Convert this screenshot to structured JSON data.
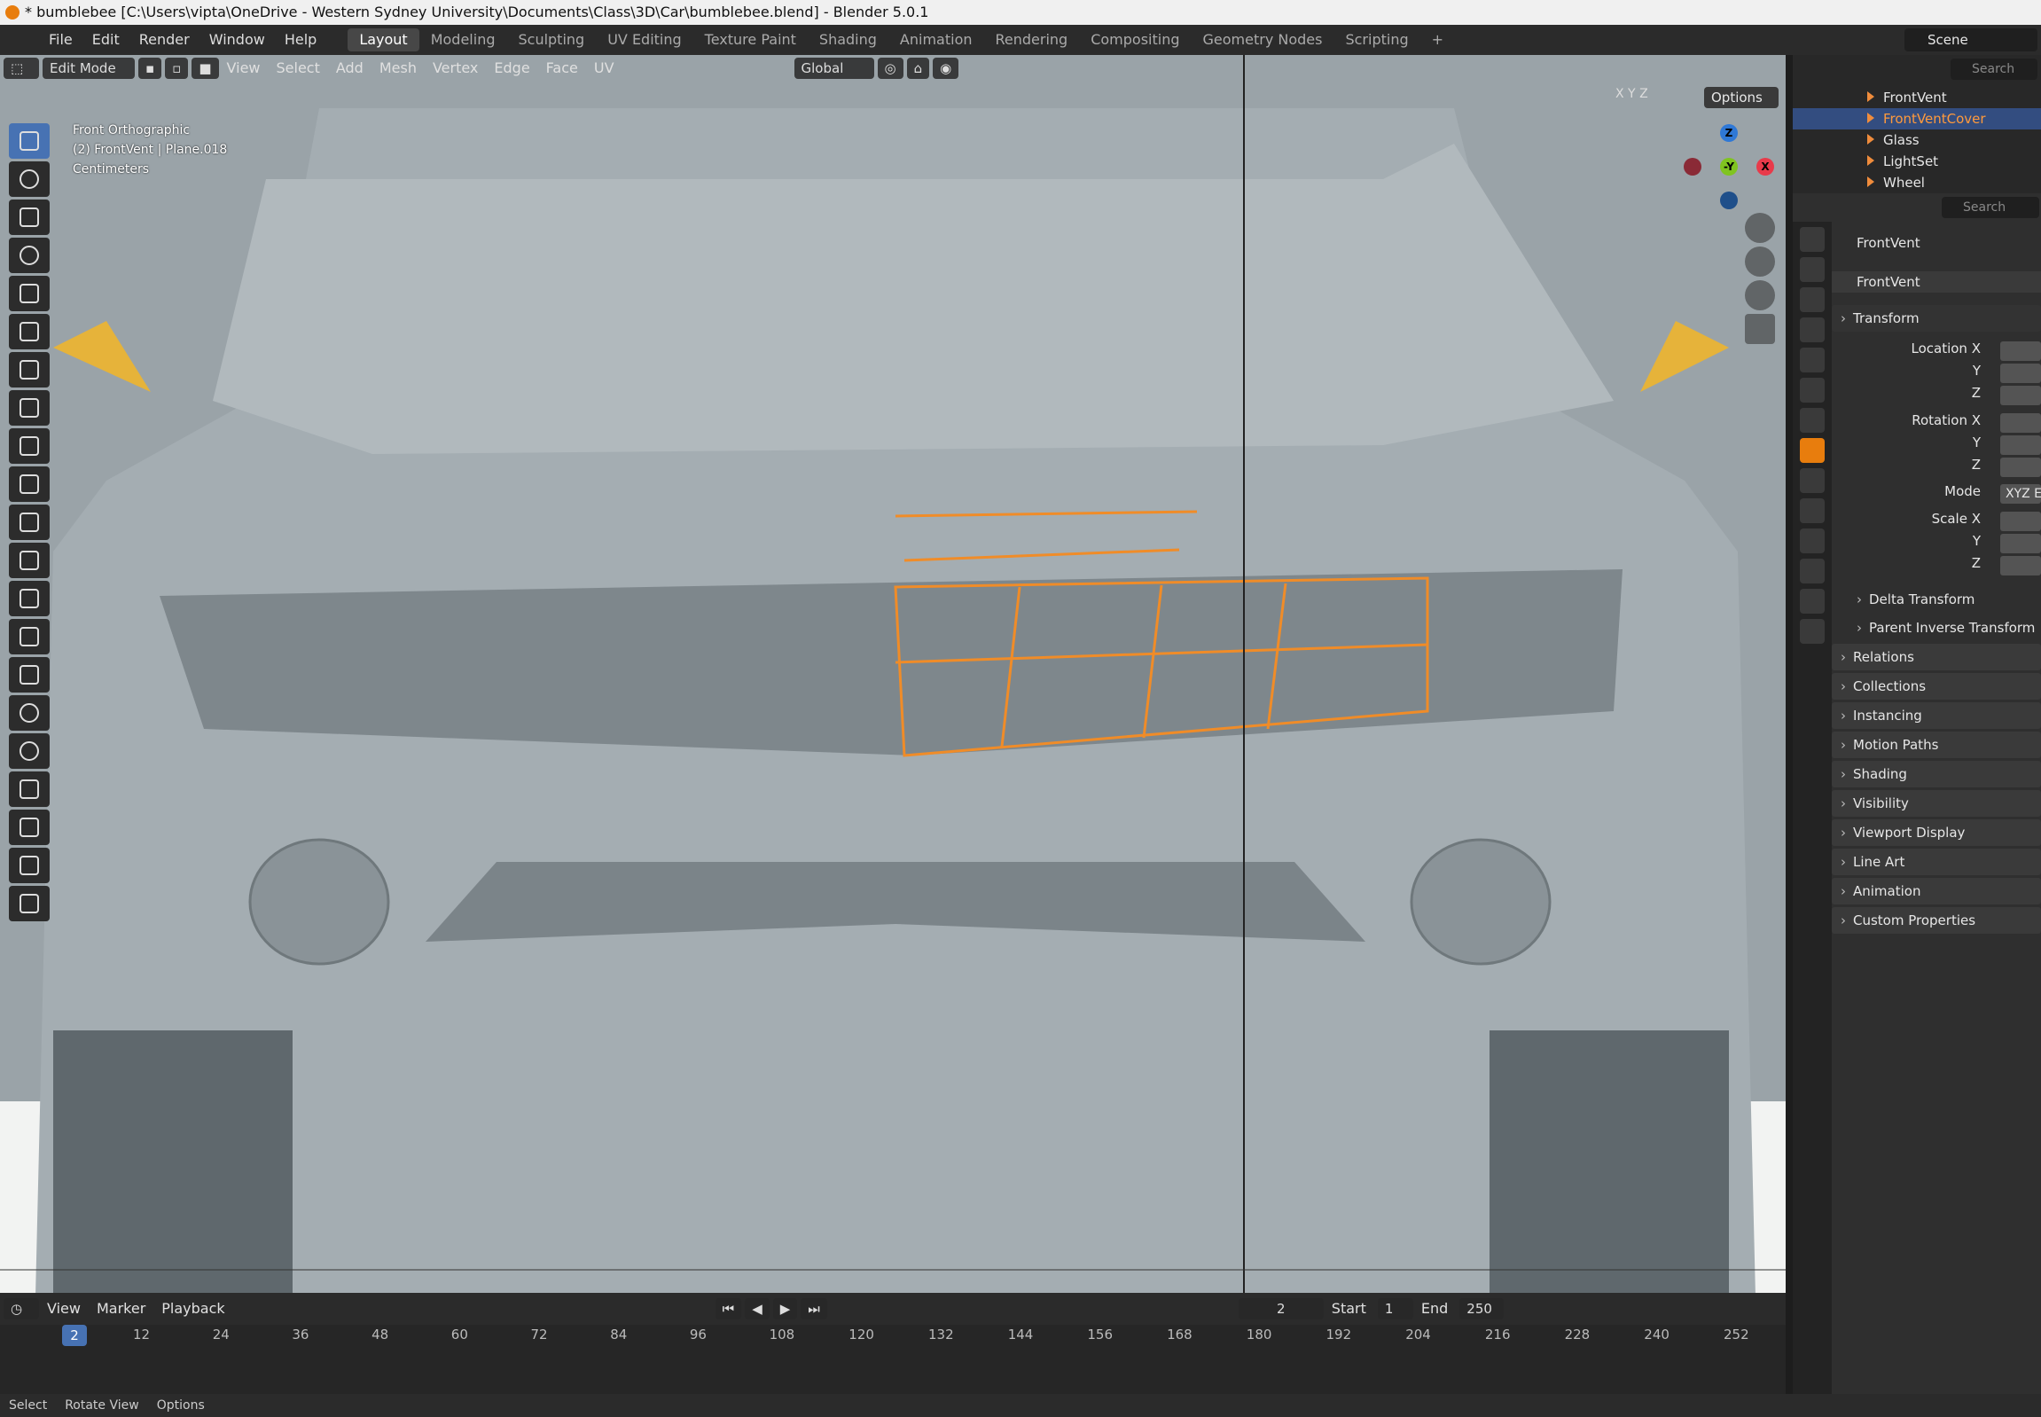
{
  "window": {
    "title": "* bumblebee [C:\\Users\\vipta\\OneDrive - Western Sydney University\\Documents\\Class\\3D\\Car\\bumblebee.blend] - Blender 5.0.1"
  },
  "menu": [
    "File",
    "Edit",
    "Render",
    "Window",
    "Help"
  ],
  "workspaces": [
    "Layout",
    "Modeling",
    "Sculpting",
    "UV Editing",
    "Texture Paint",
    "Shading",
    "Animation",
    "Rendering",
    "Compositing",
    "Geometry Nodes",
    "Scripting"
  ],
  "scene": "Scene",
  "viewport": {
    "mode": "Edit Mode",
    "menus": [
      "View",
      "Select",
      "Add",
      "Mesh",
      "Vertex",
      "Edge",
      "Face",
      "UV"
    ],
    "orientation": "Global",
    "options": "Options",
    "axes": [
      "X",
      "Y",
      "Z"
    ],
    "info": [
      "Front Orthographic",
      "(2) FrontVent | Plane.018",
      "Centimeters"
    ]
  },
  "gizmo": {
    "z": "Z",
    "y": "-Y",
    "x": "X"
  },
  "outliner": {
    "search": "Search",
    "items": [
      "FrontVent",
      "FrontVentCover",
      "Glass",
      "LightSet",
      "Wheel"
    ]
  },
  "properties": {
    "search": "Search",
    "object": "FrontVent",
    "datablock": "FrontVent",
    "transform": "Transform",
    "fields": [
      "Location X",
      "Y",
      "Z",
      "Rotation X",
      "Y",
      "Z",
      "Mode",
      "Scale X",
      "Y",
      "Z"
    ],
    "mode_value": "XYZ E",
    "subs": [
      "Delta Transform",
      "Parent Inverse Transform"
    ],
    "sections": [
      "Relations",
      "Collections",
      "Instancing",
      "Motion Paths",
      "Shading",
      "Visibility",
      "Viewport Display",
      "Line Art",
      "Animation",
      "Custom Properties"
    ]
  },
  "timeline": {
    "menus": [
      "View",
      "Marker"
    ],
    "playback": "Playback",
    "frame": "2",
    "start_label": "Start",
    "start": "1",
    "end_label": "End",
    "end": "250",
    "ticks": [
      "12",
      "24",
      "36",
      "48",
      "60",
      "72",
      "84",
      "96",
      "108",
      "120",
      "132",
      "144",
      "156",
      "168",
      "180",
      "192",
      "204",
      "216",
      "228",
      "240",
      "252"
    ],
    "current": "2"
  },
  "status": [
    "Select",
    "Rotate View",
    "Options"
  ]
}
